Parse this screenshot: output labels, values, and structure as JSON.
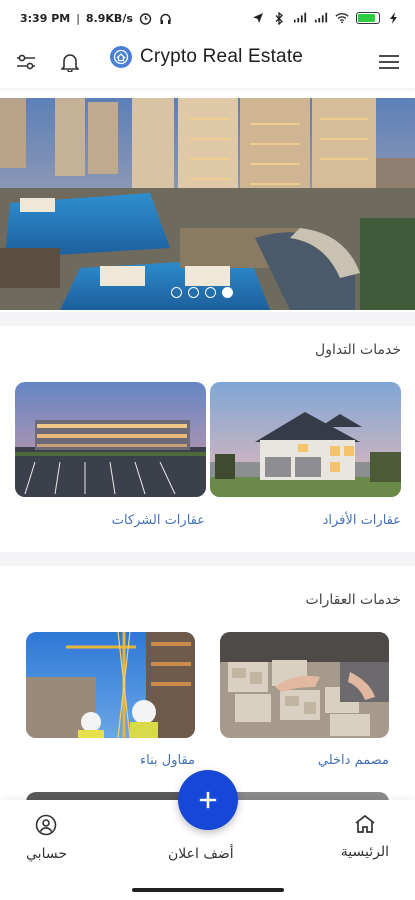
{
  "status_bar": {
    "time": "3:39 PM",
    "net_speed": "8.9KB/s",
    "battery_level": 0.85,
    "icons": [
      "alarm-icon",
      "headset-icon",
      "location-icon",
      "bluetooth-icon",
      "signal-icon",
      "signal-icon",
      "wifi-icon",
      "battery-icon",
      "charging-icon"
    ]
  },
  "app_bar": {
    "title": "Crypto Real Estate",
    "icons": [
      "filter-icon",
      "bell-icon",
      "logo-icon",
      "menu-icon"
    ]
  },
  "banner": {
    "slides": 4,
    "active_slide": 4
  },
  "trading_services": {
    "title": "خدمات التداول",
    "items": [
      {
        "label": "عقارات الأفراد",
        "image": "suburban-house-photo"
      },
      {
        "label": "عقارات الشركات",
        "image": "commercial-building-photo"
      }
    ]
  },
  "real_estate_services": {
    "title": "خدمات العقارات",
    "items": [
      {
        "label": "مصمم داخلي",
        "image": "interior-design-samples-photo"
      },
      {
        "label": "مقاول بناء",
        "image": "construction-workers-photo"
      }
    ]
  },
  "bottom_nav": {
    "home": "الرئيسية",
    "add_listing": "أضف اعلان",
    "account": "حسابي"
  },
  "colors": {
    "accent": "#1747d6",
    "label_blue": "#4470b8"
  }
}
